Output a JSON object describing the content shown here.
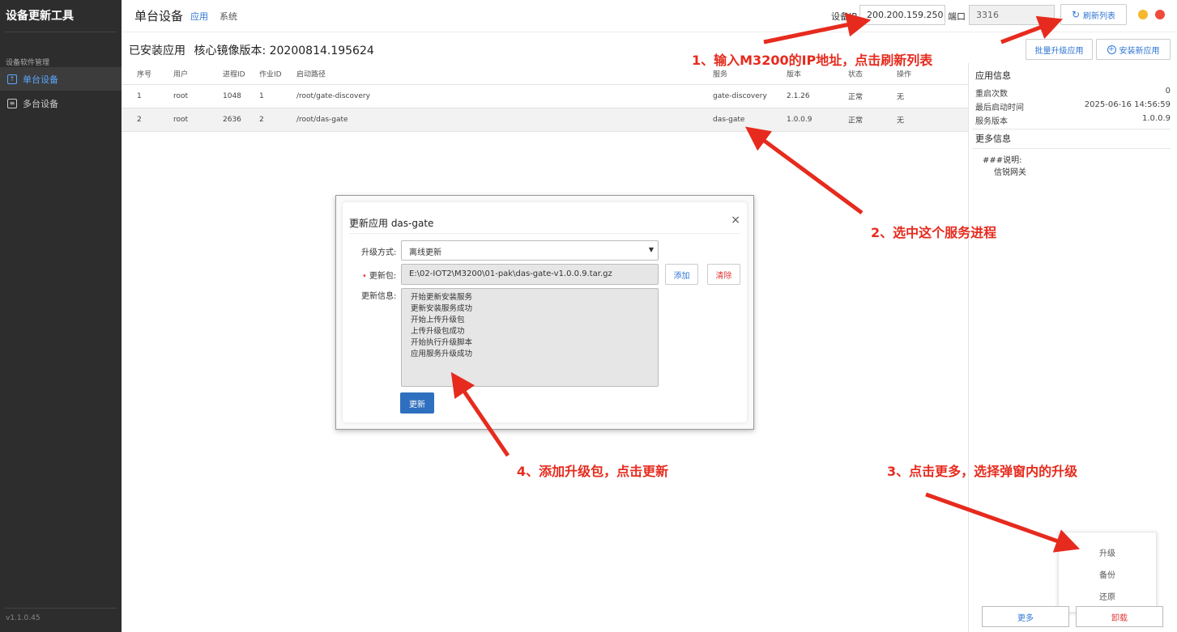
{
  "sidebar": {
    "app_title": "设备更新工具",
    "section_label": "设备软件管理",
    "items": [
      {
        "label": "单台设备",
        "icon": "upload-box-icon"
      },
      {
        "label": "多台设备",
        "icon": "list-box-icon"
      }
    ],
    "version": "v1.1.0.45"
  },
  "topbar": {
    "title": "单台设备",
    "tabs": [
      "应用",
      "系统"
    ],
    "ip_label": "设备IP",
    "ip_value": "200.200.159.250",
    "port_label": "端口",
    "port_value": "3316",
    "refresh_label": "刷新列表",
    "colors": {
      "minimize": "#f5b82e",
      "close": "#f04a3b",
      "accent": "#2f75d6"
    }
  },
  "header": {
    "title": "已安装应用",
    "image_version": "核心镜像版本: 20200814.195624",
    "batch_upgrade": "批量升级应用",
    "install_new": "安装新应用"
  },
  "table": {
    "columns": [
      "序号",
      "用户",
      "进程ID",
      "作业ID",
      "启动路径",
      "服务",
      "版本",
      "状态",
      "操作"
    ],
    "rows": [
      [
        "1",
        "root",
        "1048",
        "1",
        "/root/gate-discovery",
        "gate-discovery",
        "2.1.26",
        "正常",
        "无"
      ],
      [
        "2",
        "root",
        "2636",
        "2",
        "/root/das-gate",
        "das-gate",
        "1.0.0.9",
        "正常",
        "无"
      ]
    ],
    "selected_row": 2
  },
  "app_info": {
    "title": "应用信息",
    "restart_label": "重启次数",
    "restart_value": "0",
    "last_start_label": "最后启动时间",
    "last_start_value": "2025-06-16 14:56:59",
    "service_version_label": "服务版本",
    "service_version_value": "1.0.0.9",
    "more_title": "更多信息",
    "desc_line1": "###说明:",
    "desc_line2": "信锐网关"
  },
  "dropdown": {
    "options": [
      "升级",
      "备份",
      "还原"
    ]
  },
  "bottom": {
    "more": "更多",
    "uninstall": "卸载"
  },
  "modal": {
    "title": "更新应用 das-gate",
    "close": "×",
    "mode_label": "升级方式:",
    "mode_value": "离线更新",
    "pkg_label": "更新包:",
    "pkg_value": "E:\\02-IOT2\\M3200\\01-pak\\das-gate-v1.0.0.9.tar.gz",
    "add": "添加",
    "clear": "清除",
    "info_label": "更新信息:",
    "log": [
      "开始更新安装服务",
      "更新安装服务成功",
      "开始上传升级包",
      "上传升级包成功",
      "开始执行升级脚本",
      "应用服务升级成功"
    ],
    "update_button": "更新"
  },
  "annotations": {
    "step1": "1、输入M3200的IP地址，点击刷新列表",
    "step2": "2、选中这个服务进程",
    "step3": "3、点击更多，选择弹窗内的升级",
    "step4": "4、添加升级包，点击更新",
    "color": "#e62b1e"
  }
}
